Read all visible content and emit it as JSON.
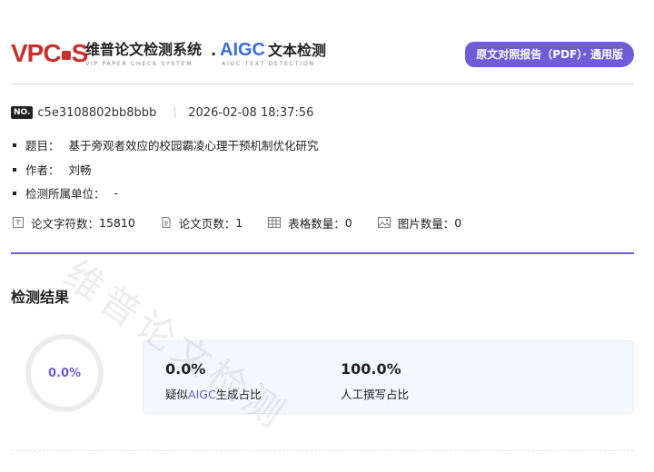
{
  "header": {
    "logo_text": "VP",
    "logo_text_2": "S",
    "logo_mid": "C",
    "brand_cn": "维普论文检测系统",
    "brand_en": "VIP PAPER CHECK SYSTEM",
    "separator": "·",
    "aigc_logo": "AIGC",
    "aigc_cn": "文本检测",
    "aigc_en": "AIGC TEXT DETECTION",
    "version_label": "原文对照报告（PDF）· 通用版"
  },
  "meta": {
    "no_badge": "NO.",
    "report_id": "c5e3108802bb8bbb",
    "datetime": "2026-02-08 18:37:56"
  },
  "info": {
    "title_label": "题目：",
    "title_value": "基于旁观者效应的校园霸凌心理干预机制优化研究",
    "author_label": "作者：",
    "author_value": "刘畅",
    "unit_label": "检测所属单位：",
    "unit_value": "-"
  },
  "stats": {
    "chars_label": "论文字符数：",
    "chars_value": "15810",
    "pages_label": "论文页数：",
    "pages_value": "1",
    "tables_label": "表格数量：",
    "tables_value": "0",
    "images_label": "图片数量：",
    "images_value": "0"
  },
  "results": {
    "section_title": "检测结果",
    "ring_value": "0.0%",
    "ring_fraction": 0.0,
    "aigc_value": "0.0%",
    "aigc_label_pre": "疑似",
    "aigc_label_accent": "AIGC",
    "aigc_label_post": "生成占比",
    "human_value": "100.0%",
    "human_label": "人工撰写占比"
  },
  "watermark": "维普论文检测",
  "colors": {
    "accent": "#6f5cd6",
    "brand_red": "#c9302c",
    "aigc_blue": "#3b6fd8"
  }
}
